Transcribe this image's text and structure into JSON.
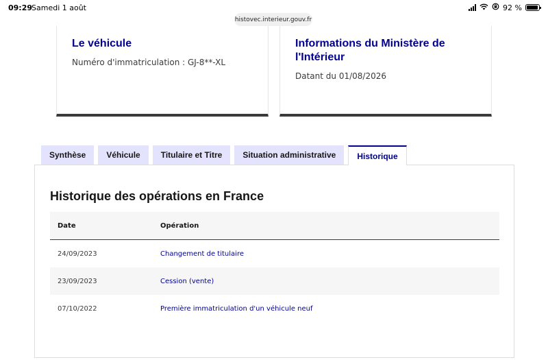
{
  "status_bar": {
    "time": "09:29",
    "date": "Samedi 1 août",
    "battery": "92 %",
    "battery_level": 0.92
  },
  "browser": {
    "url": "histovec.interieur.gouv.fr"
  },
  "cards": {
    "vehicle": {
      "title": "Le véhicule",
      "description": "Numéro d'immatriculation : GJ-8**-XL"
    },
    "ministry": {
      "title": "Informations du Ministère de l'Intérieur",
      "description": "Datant du 01/08/2026"
    }
  },
  "tabs": [
    {
      "label": "Synthèse",
      "active": false
    },
    {
      "label": "Véhicule",
      "active": false
    },
    {
      "label": "Titulaire et Titre",
      "active": false
    },
    {
      "label": "Situation administrative",
      "active": false
    },
    {
      "label": "Historique",
      "active": true
    }
  ],
  "history": {
    "title": "Historique des opérations en France",
    "columns": {
      "date": "Date",
      "operation": "Opération"
    },
    "rows": [
      {
        "date": "24/09/2023",
        "operation": "Changement de titulaire"
      },
      {
        "date": "23/09/2023",
        "operation": "Cession (vente)"
      },
      {
        "date": "07/10/2022",
        "operation": "Première immatriculation d'un véhicule neuf"
      }
    ]
  },
  "colors": {
    "primary_blue": "#000091",
    "tab_background": "#e3e3fd",
    "card_border": "#3a3a3a"
  }
}
